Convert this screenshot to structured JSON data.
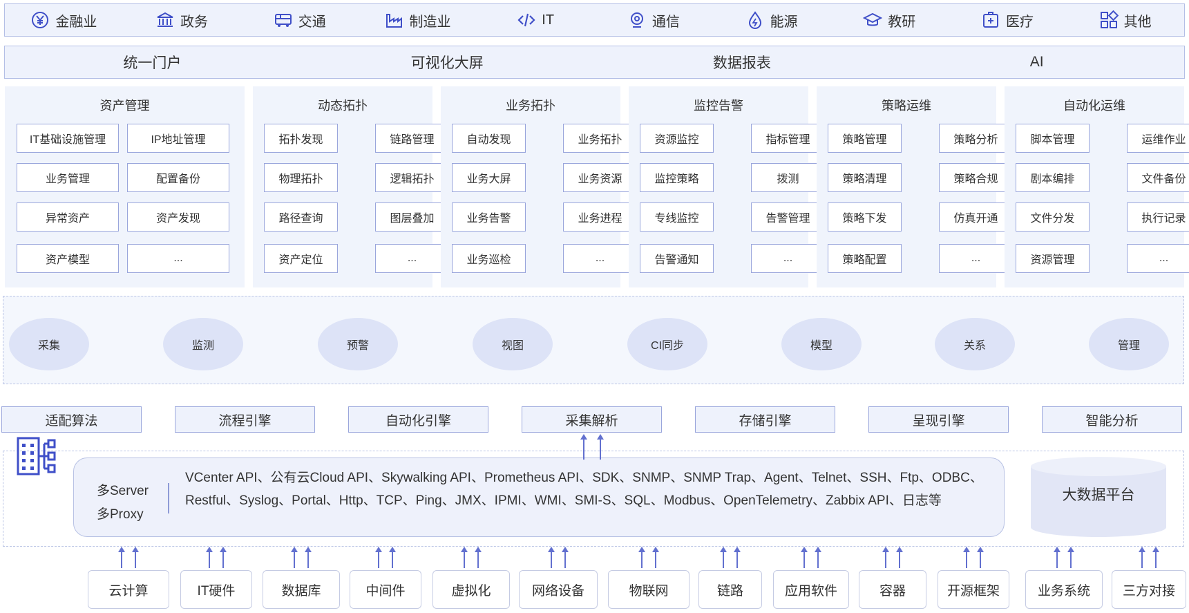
{
  "industries": [
    {
      "label": "金融业",
      "icon": "yuan-circle-icon"
    },
    {
      "label": "政务",
      "icon": "government-building-icon"
    },
    {
      "label": "交通",
      "icon": "bus-icon"
    },
    {
      "label": "制造业",
      "icon": "factory-icon"
    },
    {
      "label": "IT",
      "icon": "code-brackets-icon"
    },
    {
      "label": "通信",
      "icon": "signal-icon"
    },
    {
      "label": "能源",
      "icon": "energy-drop-icon"
    },
    {
      "label": "教研",
      "icon": "graduation-cap-icon"
    },
    {
      "label": "医疗",
      "icon": "medical-cross-icon"
    },
    {
      "label": "其他",
      "icon": "apps-grid-icon"
    }
  ],
  "platforms": [
    "统一门户",
    "可视化大屏",
    "数据报表",
    "AI"
  ],
  "modules": [
    {
      "title": "资产管理",
      "items": [
        "IT基础设施管理",
        "IP地址管理",
        "业务管理",
        "配置备份",
        "异常资产",
        "资产发现",
        "资产模型",
        "..."
      ]
    },
    {
      "title": "动态拓扑",
      "items": [
        "拓扑发现",
        "链路管理",
        "物理拓扑",
        "逻辑拓扑",
        "路径查询",
        "图层叠加",
        "资产定位",
        "..."
      ]
    },
    {
      "title": "业务拓扑",
      "items": [
        "自动发现",
        "业务拓扑",
        "业务大屏",
        "业务资源",
        "业务告警",
        "业务进程",
        "业务巡检",
        "..."
      ]
    },
    {
      "title": "监控告警",
      "items": [
        "资源监控",
        "指标管理",
        "监控策略",
        "拨测",
        "专线监控",
        "告警管理",
        "告警通知",
        "..."
      ]
    },
    {
      "title": "策略运维",
      "items": [
        "策略管理",
        "策略分析",
        "策略清理",
        "策略合规",
        "策略下发",
        "仿真开通",
        "策略配置",
        "..."
      ]
    },
    {
      "title": "自动化运维",
      "items": [
        "脚本管理",
        "运维作业",
        "剧本编排",
        "文件备份",
        "文件分发",
        "执行记录",
        "资源管理",
        "..."
      ]
    }
  ],
  "capabilities": [
    "采集",
    "监测",
    "预警",
    "视图",
    "CI同步",
    "模型",
    "关系",
    "管理"
  ],
  "engines": [
    "适配算法",
    "流程引擎",
    "自动化引擎",
    "采集解析",
    "存储引擎",
    "呈现引擎",
    "智能分析"
  ],
  "collector": {
    "server_label": "多Server",
    "proxy_label": "多Proxy",
    "protocols": "VCenter API、公有云Cloud API、Skywalking API、Prometheus API、SDK、SNMP、SNMP Trap、Agent、Telnet、SSH、Ftp、ODBC、Restful、Syslog、Portal、Http、TCP、Ping、JMX、IPMI、WMI、SMI-S、SQL、Modbus、OpenTelemetry、Zabbix API、日志等",
    "bigdata_label": "大数据平台"
  },
  "sources": [
    "云计算",
    "IT硬件",
    "数据库",
    "中间件",
    "虚拟化",
    "网络设备",
    "物联网",
    "链路",
    "应用软件",
    "容器",
    "开源框架",
    "业务系统",
    "三方对接"
  ],
  "colors": {
    "panel_bg": "#eef2fc",
    "border": "#9aa6dc",
    "accent": "#3f4fc8",
    "ellipse": "#dde3f7",
    "arrow": "#6270cf"
  }
}
